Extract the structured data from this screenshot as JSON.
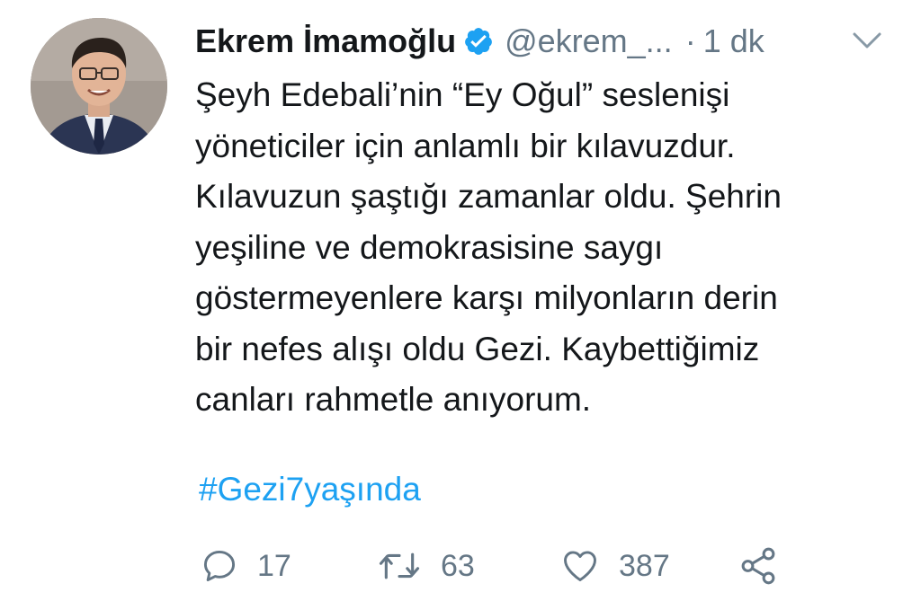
{
  "tweet": {
    "author": {
      "name": "Ekrem İmamoğlu",
      "handle": "@ekrem_...",
      "verified": true
    },
    "separator": "·",
    "time": "1 dk",
    "lines": [
      "Şeyh Edebali’nin “Ey Oğul” seslenişi",
      "yöneticiler için anlamlı bir kılavuzdur.",
      "Kılavuzun şaştığı zamanlar oldu. Şehrin",
      "yeşiline ve demokrasisine saygı",
      "göstermeyenlere karşı milyonların derin",
      "bir nefes alışı oldu Gezi. Kaybettiğimiz",
      "canları rahmetle anıyorum."
    ],
    "hashtag": "#Gezi7yaşında",
    "actions": {
      "reply": {
        "icon": "reply-icon",
        "count": "17"
      },
      "retweet": {
        "icon": "retweet-icon",
        "count": "63"
      },
      "like": {
        "icon": "heart-icon",
        "count": "387"
      },
      "share": {
        "icon": "share-icon"
      }
    }
  },
  "colors": {
    "text": "#14171a",
    "secondary": "#657786",
    "link": "#1da1f2",
    "background": "#ffffff"
  }
}
